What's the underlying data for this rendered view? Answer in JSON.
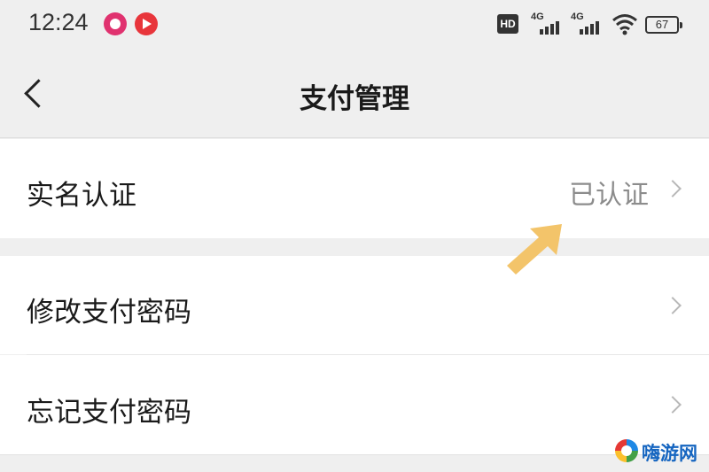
{
  "status_bar": {
    "time": "12:24",
    "hd_label": "HD",
    "signal_1_label": "4G",
    "signal_2_label": "4G",
    "battery_level": "67",
    "notification_icons": [
      "bubble-app-icon",
      "play-app-icon"
    ]
  },
  "nav": {
    "title": "支付管理",
    "back_icon": "chevron-left-icon"
  },
  "rows": [
    {
      "label": "实名认证",
      "value": "已认证",
      "icon": "chevron-right-icon"
    },
    {
      "label": "修改支付密码",
      "icon": "chevron-right-icon"
    },
    {
      "label": "忘记支付密码",
      "icon": "chevron-right-icon"
    }
  ],
  "overlay": {
    "arrow_icon": "pointer-arrow-icon",
    "arrow_color": "#f3c46a"
  },
  "watermark": {
    "text": "嗨游网",
    "color": "#1565c0"
  }
}
